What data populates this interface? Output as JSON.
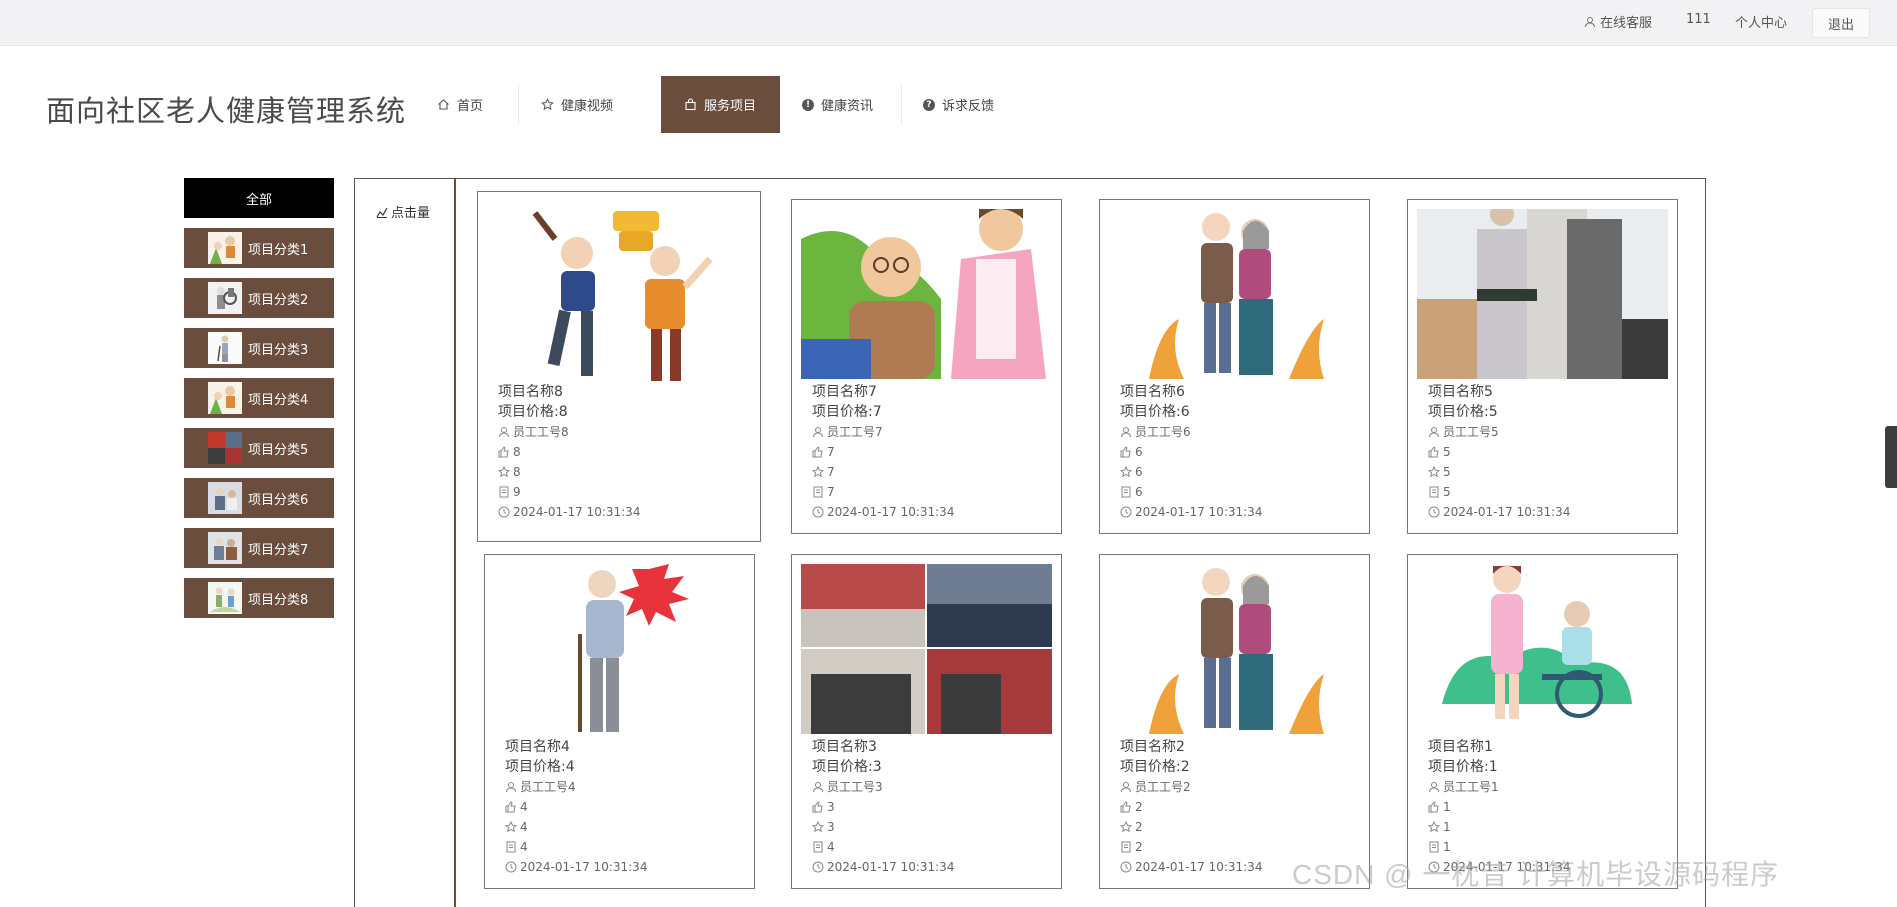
{
  "topbar": {
    "service": "在线客服",
    "user": "111",
    "center": "个人中心",
    "logout": "退出"
  },
  "site_title": "面向社区老人健康管理系统",
  "nav": [
    {
      "label": "首页",
      "icon": "home-icon"
    },
    {
      "label": "健康视频",
      "icon": "star-icon"
    },
    {
      "label": "服务项目",
      "icon": "bag-icon",
      "active": true
    },
    {
      "label": "健康资讯",
      "icon": "exclamation-icon"
    },
    {
      "label": "诉求反馈",
      "icon": "question-icon"
    }
  ],
  "categories": {
    "all": "全部",
    "items": [
      "项目分类1",
      "项目分类2",
      "项目分类3",
      "项目分类4",
      "项目分类5",
      "项目分类6",
      "项目分类7",
      "项目分类8"
    ]
  },
  "sort": {
    "label": "点击量"
  },
  "cards": [
    {
      "name": "项目名称8",
      "price": "项目价格:8",
      "staff": "员工工号8",
      "likes": "8",
      "favs": "8",
      "clicks": "9",
      "time": "2024-01-17 10:31:34"
    },
    {
      "name": "项目名称7",
      "price": "项目价格:7",
      "staff": "员工工号7",
      "likes": "7",
      "favs": "7",
      "clicks": "7",
      "time": "2024-01-17 10:31:34"
    },
    {
      "name": "项目名称6",
      "price": "项目价格:6",
      "staff": "员工工号6",
      "likes": "6",
      "favs": "6",
      "clicks": "6",
      "time": "2024-01-17 10:31:34"
    },
    {
      "name": "项目名称5",
      "price": "项目价格:5",
      "staff": "员工工号5",
      "likes": "5",
      "favs": "5",
      "clicks": "5",
      "time": "2024-01-17 10:31:34"
    },
    {
      "name": "项目名称4",
      "price": "项目价格:4",
      "staff": "员工工号4",
      "likes": "4",
      "favs": "4",
      "clicks": "4",
      "time": "2024-01-17 10:31:34"
    },
    {
      "name": "项目名称3",
      "price": "项目价格:3",
      "staff": "员工工号3",
      "likes": "3",
      "favs": "3",
      "clicks": "4",
      "time": "2024-01-17 10:31:34"
    },
    {
      "name": "项目名称2",
      "price": "项目价格:2",
      "staff": "员工工号2",
      "likes": "2",
      "favs": "2",
      "clicks": "2",
      "time": "2024-01-17 10:31:34"
    },
    {
      "name": "项目名称1",
      "price": "项目价格:1",
      "staff": "员工工号1",
      "likes": "1",
      "favs": "1",
      "clicks": "1",
      "time": "2024-01-17 10:31:34"
    }
  ],
  "watermark": "CSDN @ 一枕昔 计算机毕设源码程序",
  "colors": {
    "accent": "#6b4d3e",
    "all_bg": "#000000"
  }
}
